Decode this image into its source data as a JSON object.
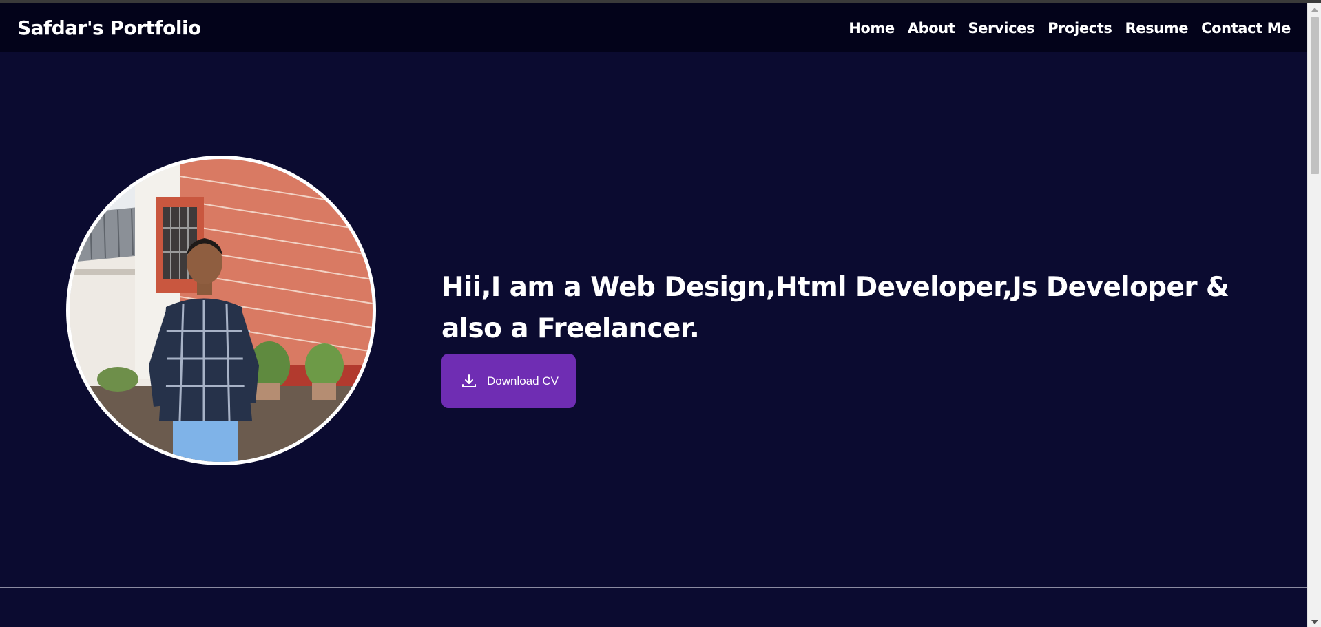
{
  "navbar": {
    "brand": "Safdar's Portfolio",
    "links": [
      {
        "label": "Home"
      },
      {
        "label": "About"
      },
      {
        "label": "Services"
      },
      {
        "label": "Projects"
      },
      {
        "label": "Resume"
      },
      {
        "label": "Contact Me"
      }
    ]
  },
  "hero": {
    "headline": "Hii,I am a Web Design,Html Developer,Js Developer & also a Freelancer.",
    "cv_button": {
      "label": "Download CV",
      "icon": "download-icon"
    },
    "profile_photo": {
      "icon": "profile-photo"
    }
  },
  "colors": {
    "page_background": "#0b0b30",
    "navbar_background": "#03031a",
    "accent_button": "#6f2db3",
    "text": "#ffffff"
  }
}
